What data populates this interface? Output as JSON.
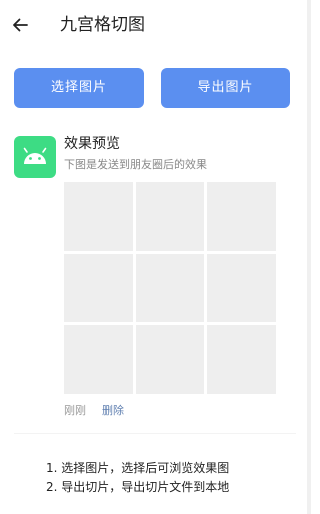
{
  "toolbar": {
    "back_icon": "arrow-left-icon",
    "title": "九宫格切图"
  },
  "actions": {
    "select_label": "选择图片",
    "export_label": "导出图片",
    "button_color": "#5b8ff0"
  },
  "preview": {
    "avatar_icon": "android-icon",
    "avatar_color": "#3ddc84",
    "name": "效果预览",
    "text": "下图是发送到朋友圈后的效果",
    "grid_cell_count": 9,
    "time": "刚刚",
    "delete_label": "删除"
  },
  "instructions": [
    "1. 选择图片，选择后可浏览效果图",
    "2. 导出切片，导出切片文件到本地"
  ]
}
